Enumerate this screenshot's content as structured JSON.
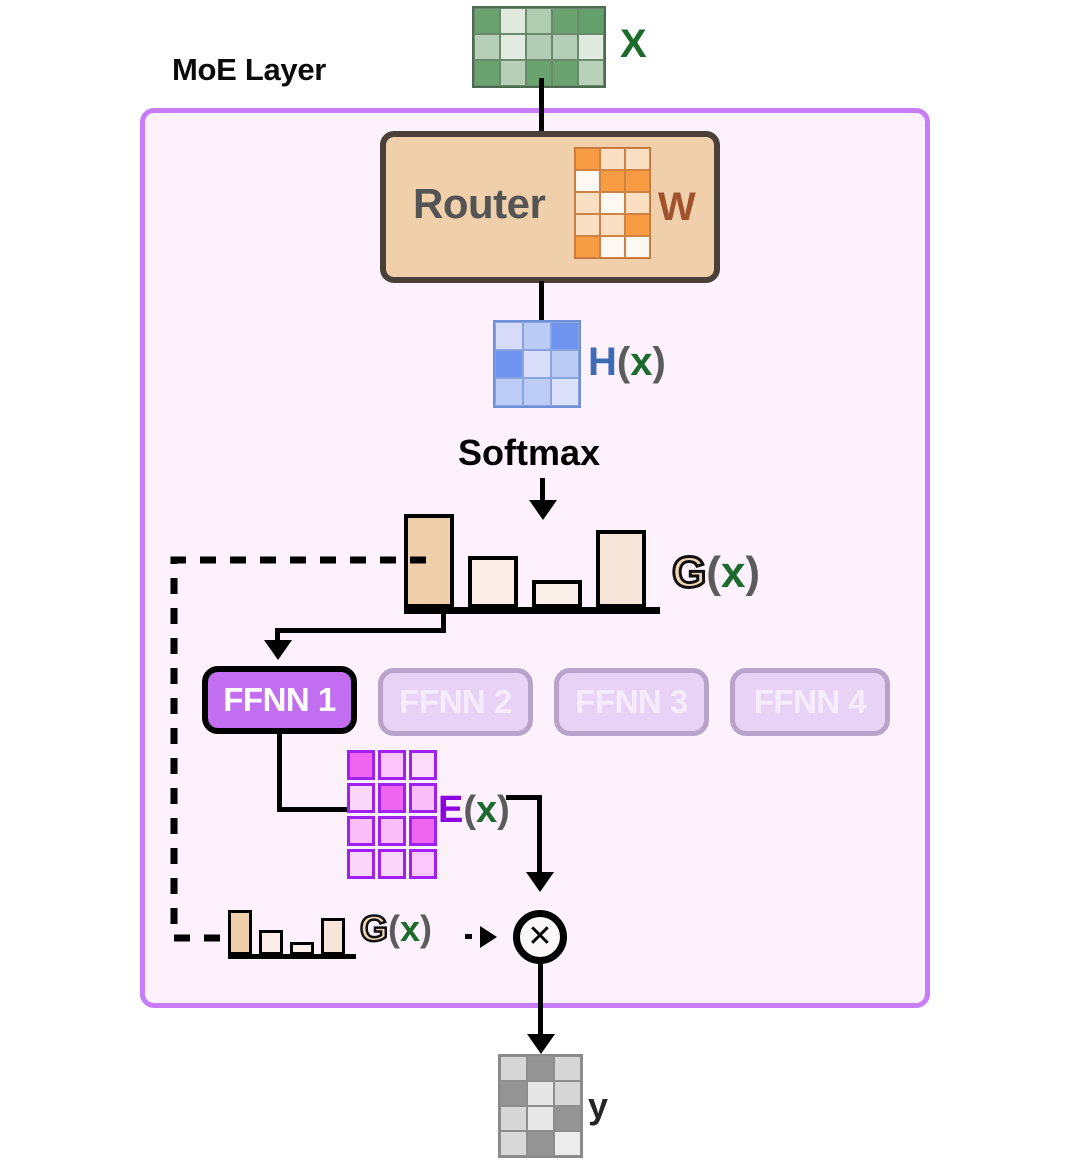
{
  "diagram": {
    "title": "MoE Layer",
    "softmax_label": "Softmax",
    "router_label": "Router",
    "multiply_symbol": "✕"
  },
  "labels": {
    "input_x": "X",
    "weight_w": "W",
    "hidden_fn": "H",
    "gate_fn": "G",
    "expert_fn": "E",
    "variable_x": "x",
    "paren_open": "(",
    "paren_close": ")",
    "output_y": "y"
  },
  "experts": [
    {
      "label": "FFNN 1",
      "state": "active"
    },
    {
      "label": "FFNN 2",
      "state": "inactive"
    },
    {
      "label": "FFNN 3",
      "state": "inactive"
    },
    {
      "label": "FFNN 4",
      "state": "inactive"
    }
  ],
  "colors": {
    "container_border": "#c77dfa",
    "container_fill": "#fdf1fd",
    "router_fill": "#f0cfab",
    "router_border": "#4a4038",
    "router_text": "#545454",
    "w_text": "#a0522d",
    "x_green": "#1d6b2c",
    "h_blue": "#3f6bb5",
    "e_purple": "#8f00e0",
    "expert_active": "#c16ef0",
    "expert_inactive": "#e8d3f6",
    "gate_tan": "#f0d5b4",
    "paren_gray": "#5b5b5b"
  },
  "matrices": {
    "x": {
      "name": "X",
      "cols": 5,
      "rows": 3,
      "cells": [
        "#6aa370",
        "#dfeadd",
        "#b0cdb1",
        "#6aa370",
        "#63a06c",
        "#b6d0b7",
        "#e2ece0",
        "#b2cdb3",
        "#b4cfb5",
        "#e0ebdf",
        "#6aa370",
        "#b6d0b7",
        "#6aa370",
        "#6aa370",
        "#b8d1b9"
      ]
    },
    "w": {
      "name": "W",
      "cols": 3,
      "rows": 5,
      "cells": [
        "#f79c42",
        "#fadfc2",
        "#fbdfc3",
        "#fdf9f2",
        "#f79c42",
        "#f79c42",
        "#fadfc2",
        "#fdf9f2",
        "#fadfc2",
        "#fadfc2",
        "#fadfc2",
        "#f79c42",
        "#f79c42",
        "#fdf9f2",
        "#fdf9f2"
      ]
    },
    "h": {
      "name": "H(x)",
      "cols": 3,
      "rows": 3,
      "cells": [
        "#d6dcf7",
        "#bacbf4",
        "#6f94ef",
        "#6f94ef",
        "#d8defa",
        "#bacbf4",
        "#bdcdf5",
        "#bdcdf5",
        "#dbe1fa"
      ]
    },
    "e": {
      "name": "E(x)",
      "cols": 3,
      "rows": 4,
      "cells": [
        "#ef65ef",
        "#fbc4fb",
        "#fbdcfb",
        "#fbd8fb",
        "#ef65ef",
        "#fabefa",
        "#fabefa",
        "#fabefa",
        "#ef65ef",
        "#fbd8fb",
        "#fbd8fb",
        "#fbc8fb"
      ]
    },
    "y": {
      "name": "y",
      "cols": 3,
      "rows": 4,
      "cells": [
        "#d6d6d6",
        "#949494",
        "#d6d6d6",
        "#949494",
        "#e6e6e6",
        "#d6d6d6",
        "#d6d6d6",
        "#e8e8e8",
        "#949494",
        "#d8d8d8",
        "#949494",
        "#ececec"
      ]
    }
  },
  "chart_data": [
    {
      "type": "bar",
      "title": "G(x)",
      "categories": [
        "FFNN 1",
        "FFNN 2",
        "FFNN 3",
        "FFNN 4"
      ],
      "values": [
        0.94,
        0.52,
        0.28,
        0.78
      ],
      "bar_colors": [
        "#f0cfab",
        "#faeee6",
        "#faf0e9",
        "#f7e5da"
      ],
      "xlabel": "",
      "ylabel": "",
      "ylim": [
        0,
        1
      ],
      "grid": false,
      "legend": false
    },
    {
      "type": "bar",
      "title": "G(x)",
      "categories": [
        "FFNN 1",
        "FFNN 2",
        "FFNN 3",
        "FFNN 4"
      ],
      "values": [
        0.94,
        0.52,
        0.28,
        0.78
      ],
      "bar_colors": [
        "#f0cfab",
        "#faeee6",
        "#faf0e9",
        "#f7e5da"
      ],
      "xlabel": "",
      "ylabel": "",
      "ylim": [
        0,
        1
      ],
      "grid": false,
      "legend": false
    }
  ]
}
